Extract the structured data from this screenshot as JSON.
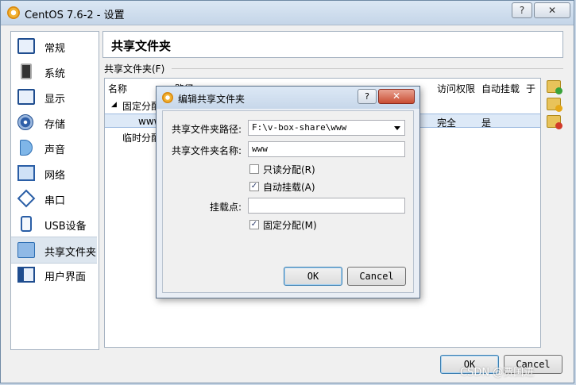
{
  "window": {
    "title": "CentOS 7.6-2 - 设置",
    "help_glyph": "?",
    "close_glyph": "✕"
  },
  "sidebar": {
    "items": [
      {
        "label": "常规",
        "icon": "monitor-icon"
      },
      {
        "label": "系统",
        "icon": "chip-icon"
      },
      {
        "label": "显示",
        "icon": "display-icon"
      },
      {
        "label": "存储",
        "icon": "disk-icon"
      },
      {
        "label": "声音",
        "icon": "speaker-icon"
      },
      {
        "label": "网络",
        "icon": "network-icon"
      },
      {
        "label": "串口",
        "icon": "serial-port-icon"
      },
      {
        "label": "USB设备",
        "icon": "usb-icon"
      },
      {
        "label": "共享文件夹",
        "icon": "folder-icon",
        "selected": true
      },
      {
        "label": "用户界面",
        "icon": "user-interface-icon"
      }
    ]
  },
  "main": {
    "page_title": "共享文件夹",
    "section_label": "共享文件夹(F)",
    "table": {
      "headers": {
        "name": "名称",
        "path": "路径",
        "access": "访问权限",
        "automount": "自动挂载",
        "at": "于"
      },
      "group_fixed": "固定分配",
      "row": {
        "name": "www",
        "access": "完全",
        "automount": "是"
      },
      "group_temp": "临时分配"
    },
    "ok_label": "OK",
    "cancel_label": "Cancel"
  },
  "dialog": {
    "title": "编辑共享文件夹",
    "help_glyph": "?",
    "close_glyph": "✕",
    "path_label": "共享文件夹路径:",
    "path_value": "F:\\v-box-share\\www",
    "name_label": "共享文件夹名称:",
    "name_value": "www",
    "readonly_label": "只读分配(R)",
    "readonly_checked": false,
    "automount_label": "自动挂载(A)",
    "automount_checked": true,
    "mountpoint_label": "挂载点:",
    "mountpoint_value": "",
    "permanent_label": "固定分配(M)",
    "permanent_checked": true,
    "ok_label": "OK",
    "cancel_label": "Cancel",
    "check_glyph": "✓"
  },
  "watermark": "CSDN @贾国进",
  "colors": {
    "accent": "#3c7fb1",
    "close_red": "#c94d33",
    "selection": "#dde9f7"
  }
}
